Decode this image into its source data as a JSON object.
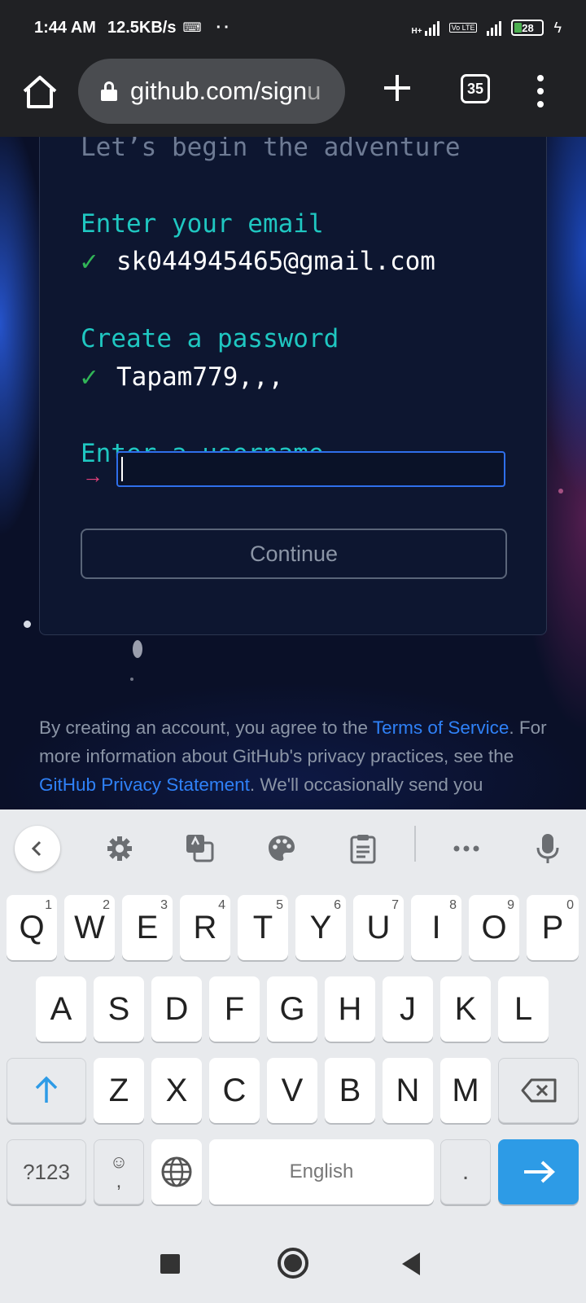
{
  "status_bar": {
    "time": "1:44 AM",
    "speed": "12.5KB/s",
    "dots": "··",
    "network_badge": "H+",
    "lte_label": "Vo LTE",
    "battery": "28"
  },
  "browser": {
    "url_main": "github.com/sign",
    "url_rest": "u",
    "tab_count": "35"
  },
  "form": {
    "subtitle": "Let’s begin the adventure",
    "email_label": "Enter your email",
    "email_value": "sk044945465@gmail.com",
    "password_label": "Create a password",
    "password_value": "Tapam779,,,",
    "username_label": "Enter a username",
    "username_value": "",
    "arrow": "→",
    "check": "✓",
    "continue_label": "Continue"
  },
  "footer": {
    "text_1": "By creating an account, you agree to the ",
    "terms_link": "Terms of Service",
    "text_2": ". For more information about GitHub's privacy practices, see the ",
    "privacy_link": "GitHub Privacy Statement",
    "text_3": ". We'll occasionally send you"
  },
  "keyboard": {
    "row1": [
      {
        "key": "Q",
        "hint": "1"
      },
      {
        "key": "W",
        "hint": "2"
      },
      {
        "key": "E",
        "hint": "3"
      },
      {
        "key": "R",
        "hint": "4"
      },
      {
        "key": "T",
        "hint": "5"
      },
      {
        "key": "Y",
        "hint": "6"
      },
      {
        "key": "U",
        "hint": "7"
      },
      {
        "key": "I",
        "hint": "8"
      },
      {
        "key": "O",
        "hint": "9"
      },
      {
        "key": "P",
        "hint": "0"
      }
    ],
    "row2": [
      "A",
      "S",
      "D",
      "F",
      "G",
      "H",
      "J",
      "K",
      "L"
    ],
    "row3": [
      "Z",
      "X",
      "C",
      "V",
      "B",
      "N",
      "M"
    ],
    "symbols_label": "?123",
    "comma_label": ",",
    "space_label": "English",
    "period_label": "."
  },
  "colors": {
    "accent_teal": "#1fc7c1",
    "check_green": "#31b557",
    "link_blue": "#2f81f7",
    "enter_blue": "#2d9be6"
  }
}
